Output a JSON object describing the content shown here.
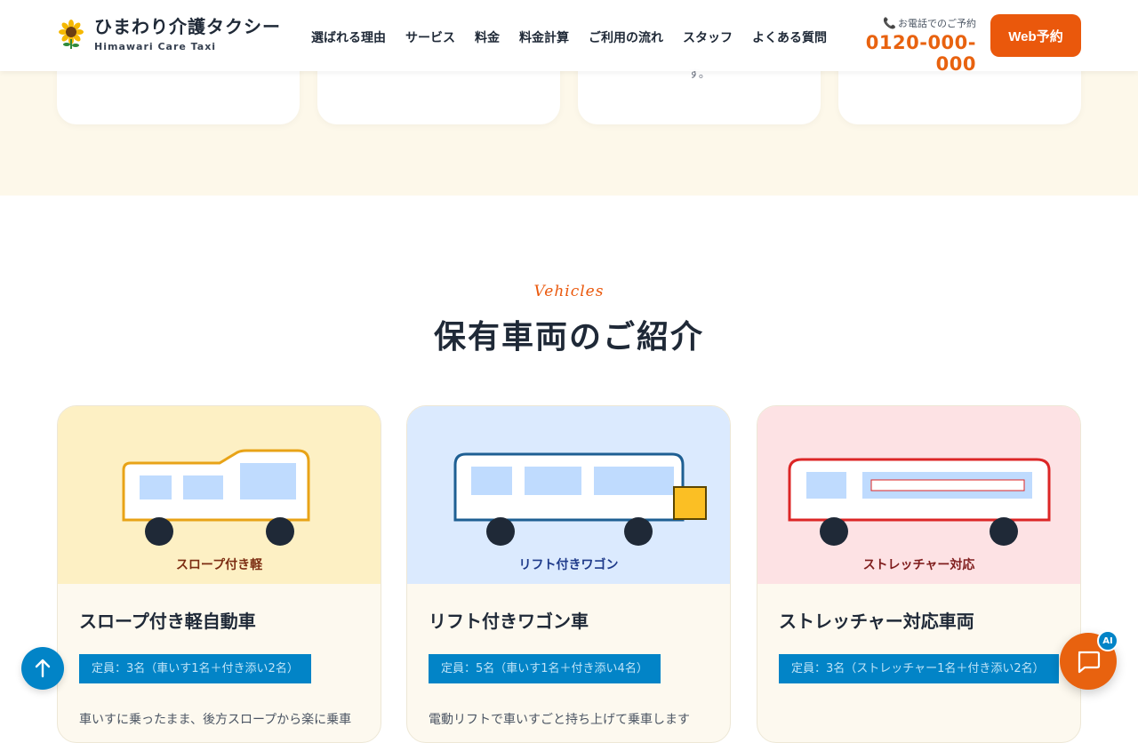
{
  "brand": {
    "title": "ひまわり介護タクシー",
    "subtitle": "Himawari Care Taxi"
  },
  "nav": {
    "items": [
      "選ばれる理由",
      "サービス",
      "料金",
      "料金計算",
      "ご利用の流れ",
      "スタッフ",
      "よくある質問"
    ]
  },
  "contact": {
    "phone_label": "お電話でのご予約",
    "phone_number": "0120-000-000",
    "web_button": "Web予約"
  },
  "prev_section": {
    "card_tail_text": "す。"
  },
  "vehicles_section": {
    "eyebrow": "Vehicles",
    "heading": "保有車両のご紹介",
    "cards": [
      {
        "image_label": "スロープ付き軽",
        "name": "スロープ付き軽自動車",
        "capacity": "定員：3名（車いす1名＋付き添い2名）",
        "description": "車いすに乗ったまま、後方スロープから楽に乗車"
      },
      {
        "image_label": "リフト付きワゴン",
        "name": "リフト付きワゴン車",
        "capacity": "定員：5名（車いす1名＋付き添い4名）",
        "description": "電動リフトで車いすごと持ち上げて乗車します"
      },
      {
        "image_label": "ストレッチャー対応",
        "name": "ストレッチャー対応車両",
        "capacity": "定員：3名（ストレッチャー1名＋付き添い2名）",
        "description": ""
      }
    ]
  },
  "floating": {
    "ai_badge": "AI"
  },
  "colors": {
    "accent_orange": "#ea580c",
    "accent_blue": "#0284c7",
    "band_cream": "#fdf8ea"
  }
}
